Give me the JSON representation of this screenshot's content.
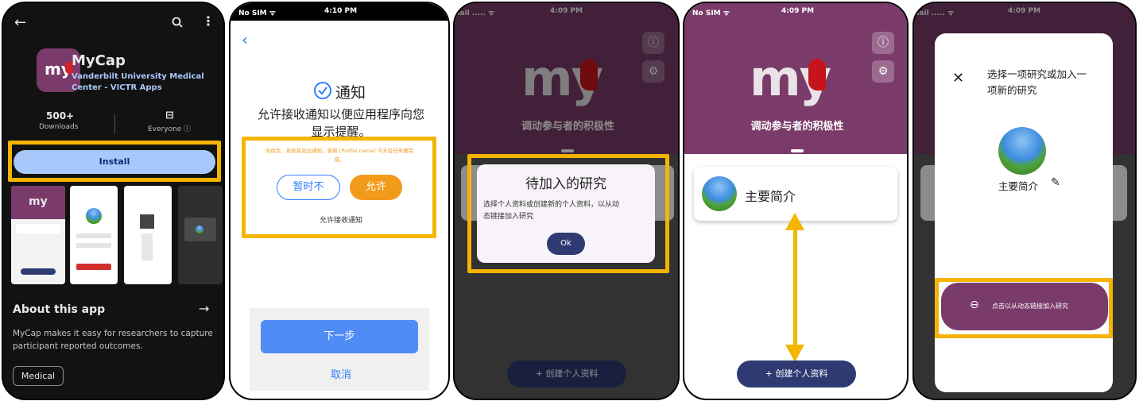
{
  "p1": {
    "app_name": "MyCap",
    "developer_line1": "Vanderbilt University Medical",
    "developer_line2": "Center - VICTR Apps",
    "downloads_value": "500+",
    "downloads_label": "Downloads",
    "rating_label": "Everyone ⓘ",
    "install_label": "Install",
    "about_title": "About this app",
    "about_line1": "MyCap makes it easy for researchers to capture",
    "about_line2": "participant reported outcomes.",
    "chip": "Medical",
    "logo_text": "my"
  },
  "p2": {
    "status_left": "No SIM ᯤ",
    "status_time": "4:10 PM",
    "title": "通知",
    "desc_line1": "允许接收通知以便应用程序向您",
    "desc_line2": "显示提醒。",
    "small_notice_line1": "当你负、系统将发出通知。若和 [Profile name] 今天有任务要完",
    "small_notice_line2": "成。",
    "not_now": "暂时不",
    "allow": "允许",
    "allow_link": "允许接收通知",
    "next": "下一步",
    "cancel": "取消"
  },
  "p3": {
    "status_left": "nail ..... ᯤ",
    "status_time": "4:09 PM",
    "logo_text": "my",
    "tagline": "调动参与者的积极性",
    "dialog_title": "待加入的研究",
    "dialog_body_line1": "选择个人资料或创建新的个人资料，以从动",
    "dialog_body_line2": "态链接加入研究",
    "ok": "Ok",
    "create_btn": "+ 创建个人资料"
  },
  "p4": {
    "status_left": "No SIM ᯤ",
    "status_time": "4:09 PM",
    "logo_text": "my",
    "tagline": "调动参与者的积极性",
    "profile_name": "主要简介",
    "create_btn": "+ 创建个人资料"
  },
  "p5": {
    "status_left": "nail ..... ᯤ",
    "status_time": "4:09 PM",
    "sheet_title_line1": "选择一项研究或加入一",
    "sheet_title_line2": "项新的研究",
    "profile_name": "主要简介",
    "join_btn": "点击以从动态链接加入研究"
  },
  "colors": {
    "highlight": "#f4b400",
    "brand_purple": "#7a3b6b",
    "navy": "#2f3a73",
    "blue": "#2d7ff9",
    "orange": "#f29a1a"
  }
}
